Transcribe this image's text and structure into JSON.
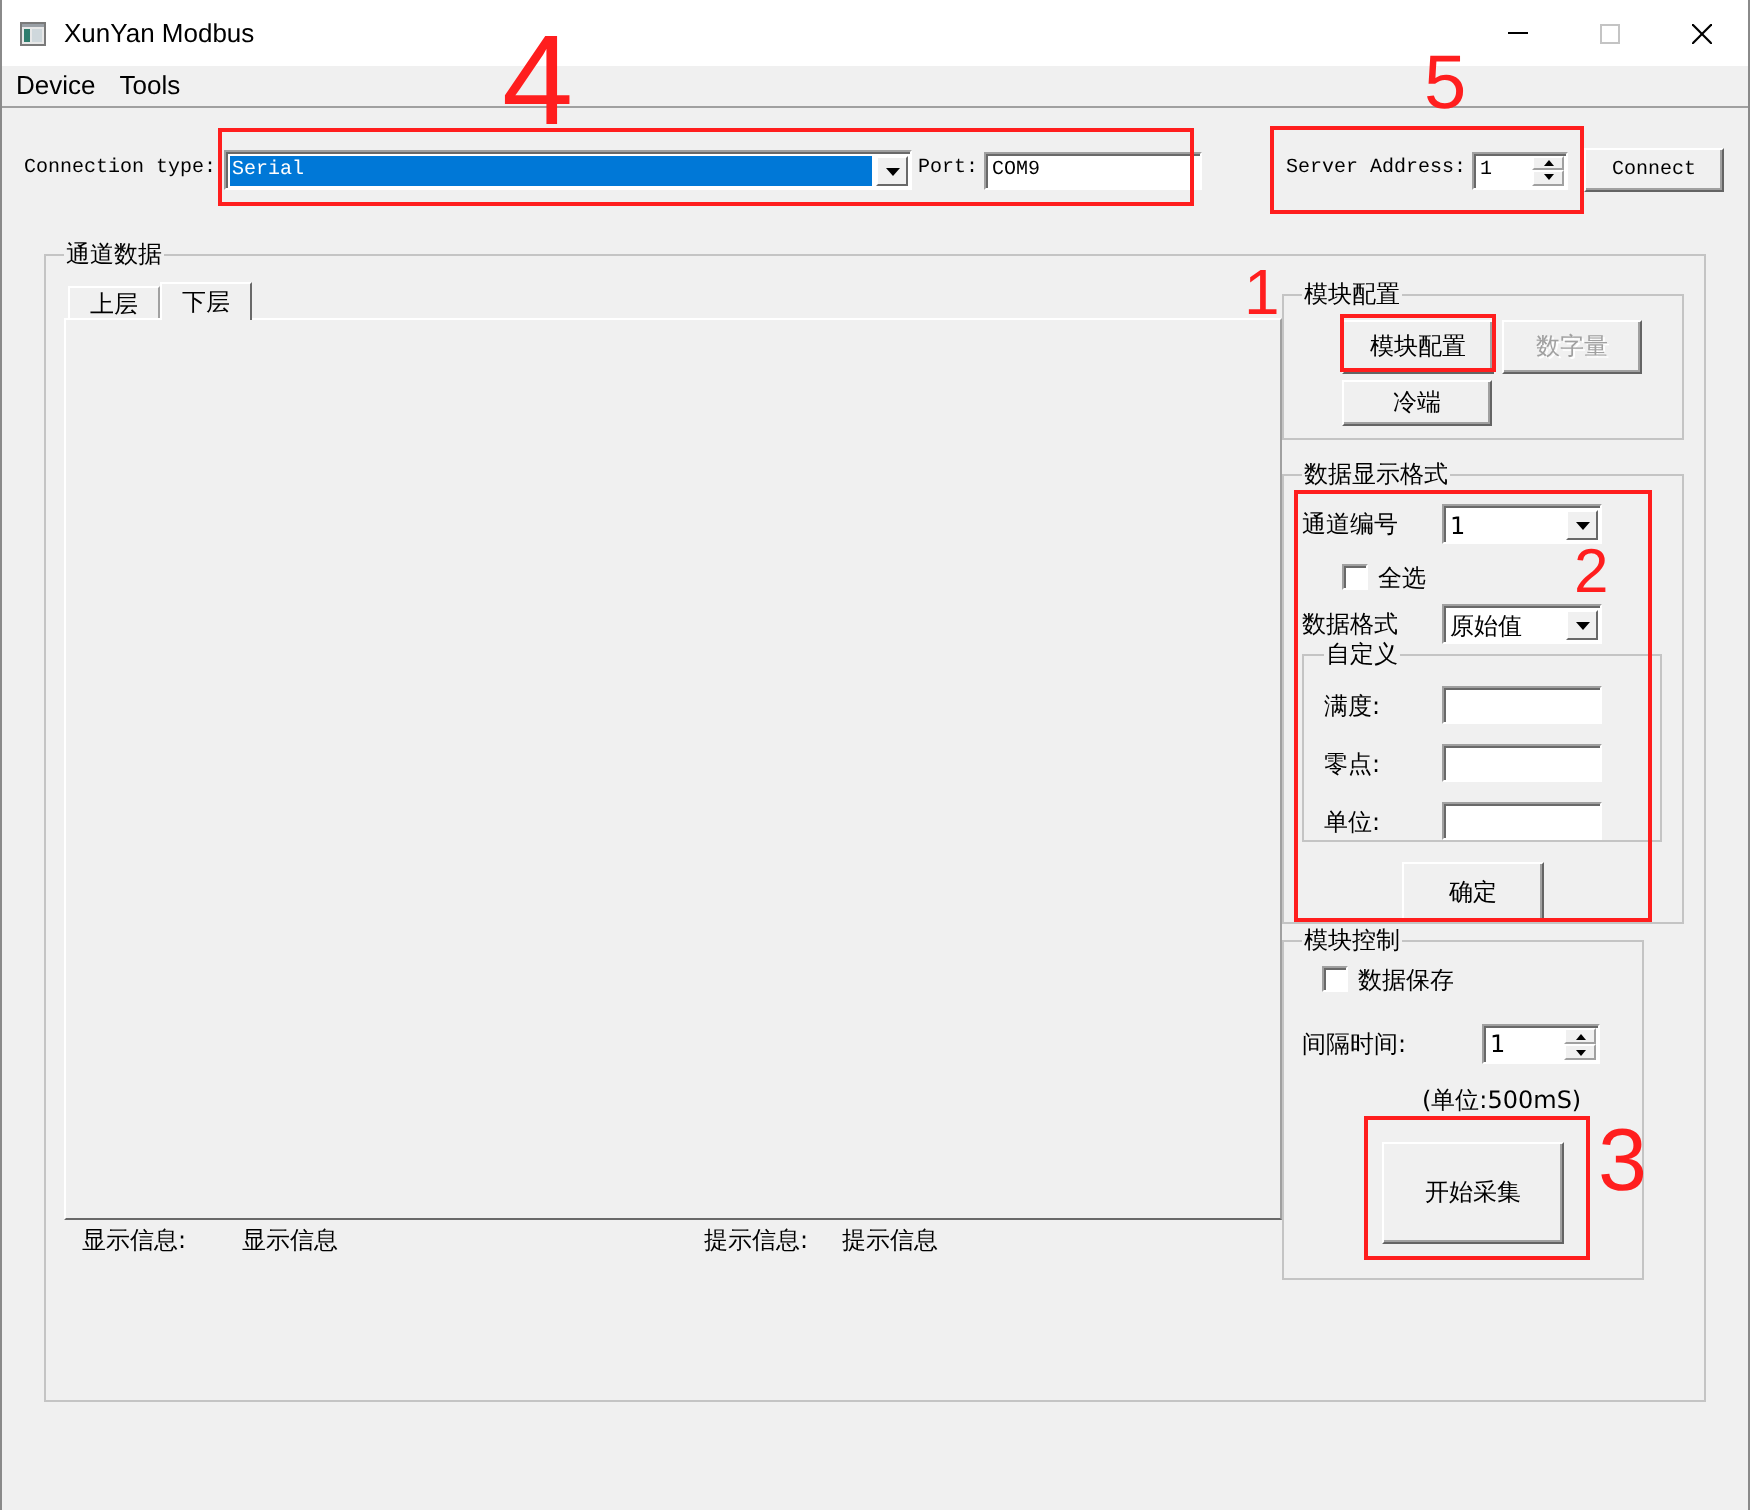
{
  "window": {
    "title": "XunYan Modbus",
    "controls": [
      {
        "kind": "minimize",
        "disabled": false
      },
      {
        "kind": "maximize",
        "disabled": true
      },
      {
        "kind": "close",
        "disabled": false
      }
    ]
  },
  "menu": [
    {
      "label": "Device"
    },
    {
      "label": "Tools"
    }
  ],
  "connection": {
    "label": "Connection type:",
    "type_value": "Serial",
    "focused": true,
    "port_label": "Port:",
    "port_value": "COM9",
    "annotation": "4"
  },
  "server": {
    "label": "Server Address:",
    "value": "1",
    "annotation": "5"
  },
  "connect_button": "Connect",
  "channel_data": {
    "title": "通道数据",
    "tabs": [
      {
        "label": "上层",
        "selected": false
      },
      {
        "label": "下层",
        "selected": true
      }
    ],
    "info": [
      {
        "label": "显示信息:",
        "value": "显示信息"
      },
      {
        "label": "提示信息:",
        "value": "提示信息"
      }
    ]
  },
  "module_config": {
    "title": "模块配置",
    "buttons": [
      {
        "label": "模块配置",
        "disabled": false,
        "annotation": "1"
      },
      {
        "label": "数字量",
        "disabled": true
      },
      {
        "label": "冷端",
        "disabled": false
      }
    ]
  },
  "display_format": {
    "title": "数据显示格式",
    "annotation": "2",
    "channel_label": "通道编号",
    "channel_value": "1",
    "select_all": {
      "label": "全选",
      "checked": false
    },
    "format_label": "数据格式",
    "format_value": "原始值",
    "custom": {
      "title": "自定义",
      "fields": [
        {
          "label": "满度:"
        },
        {
          "label": "零点:"
        },
        {
          "label": "单位:"
        }
      ]
    },
    "confirm_button": "确定"
  },
  "module_control": {
    "title": "模块控制",
    "save_data": {
      "label": "数据保存",
      "checked": false
    },
    "interval_label": "间隔时间:",
    "interval_value": "1",
    "unit_note": "(单位:500mS)",
    "start_button": {
      "label": "开始采集",
      "annotation": "3"
    }
  }
}
